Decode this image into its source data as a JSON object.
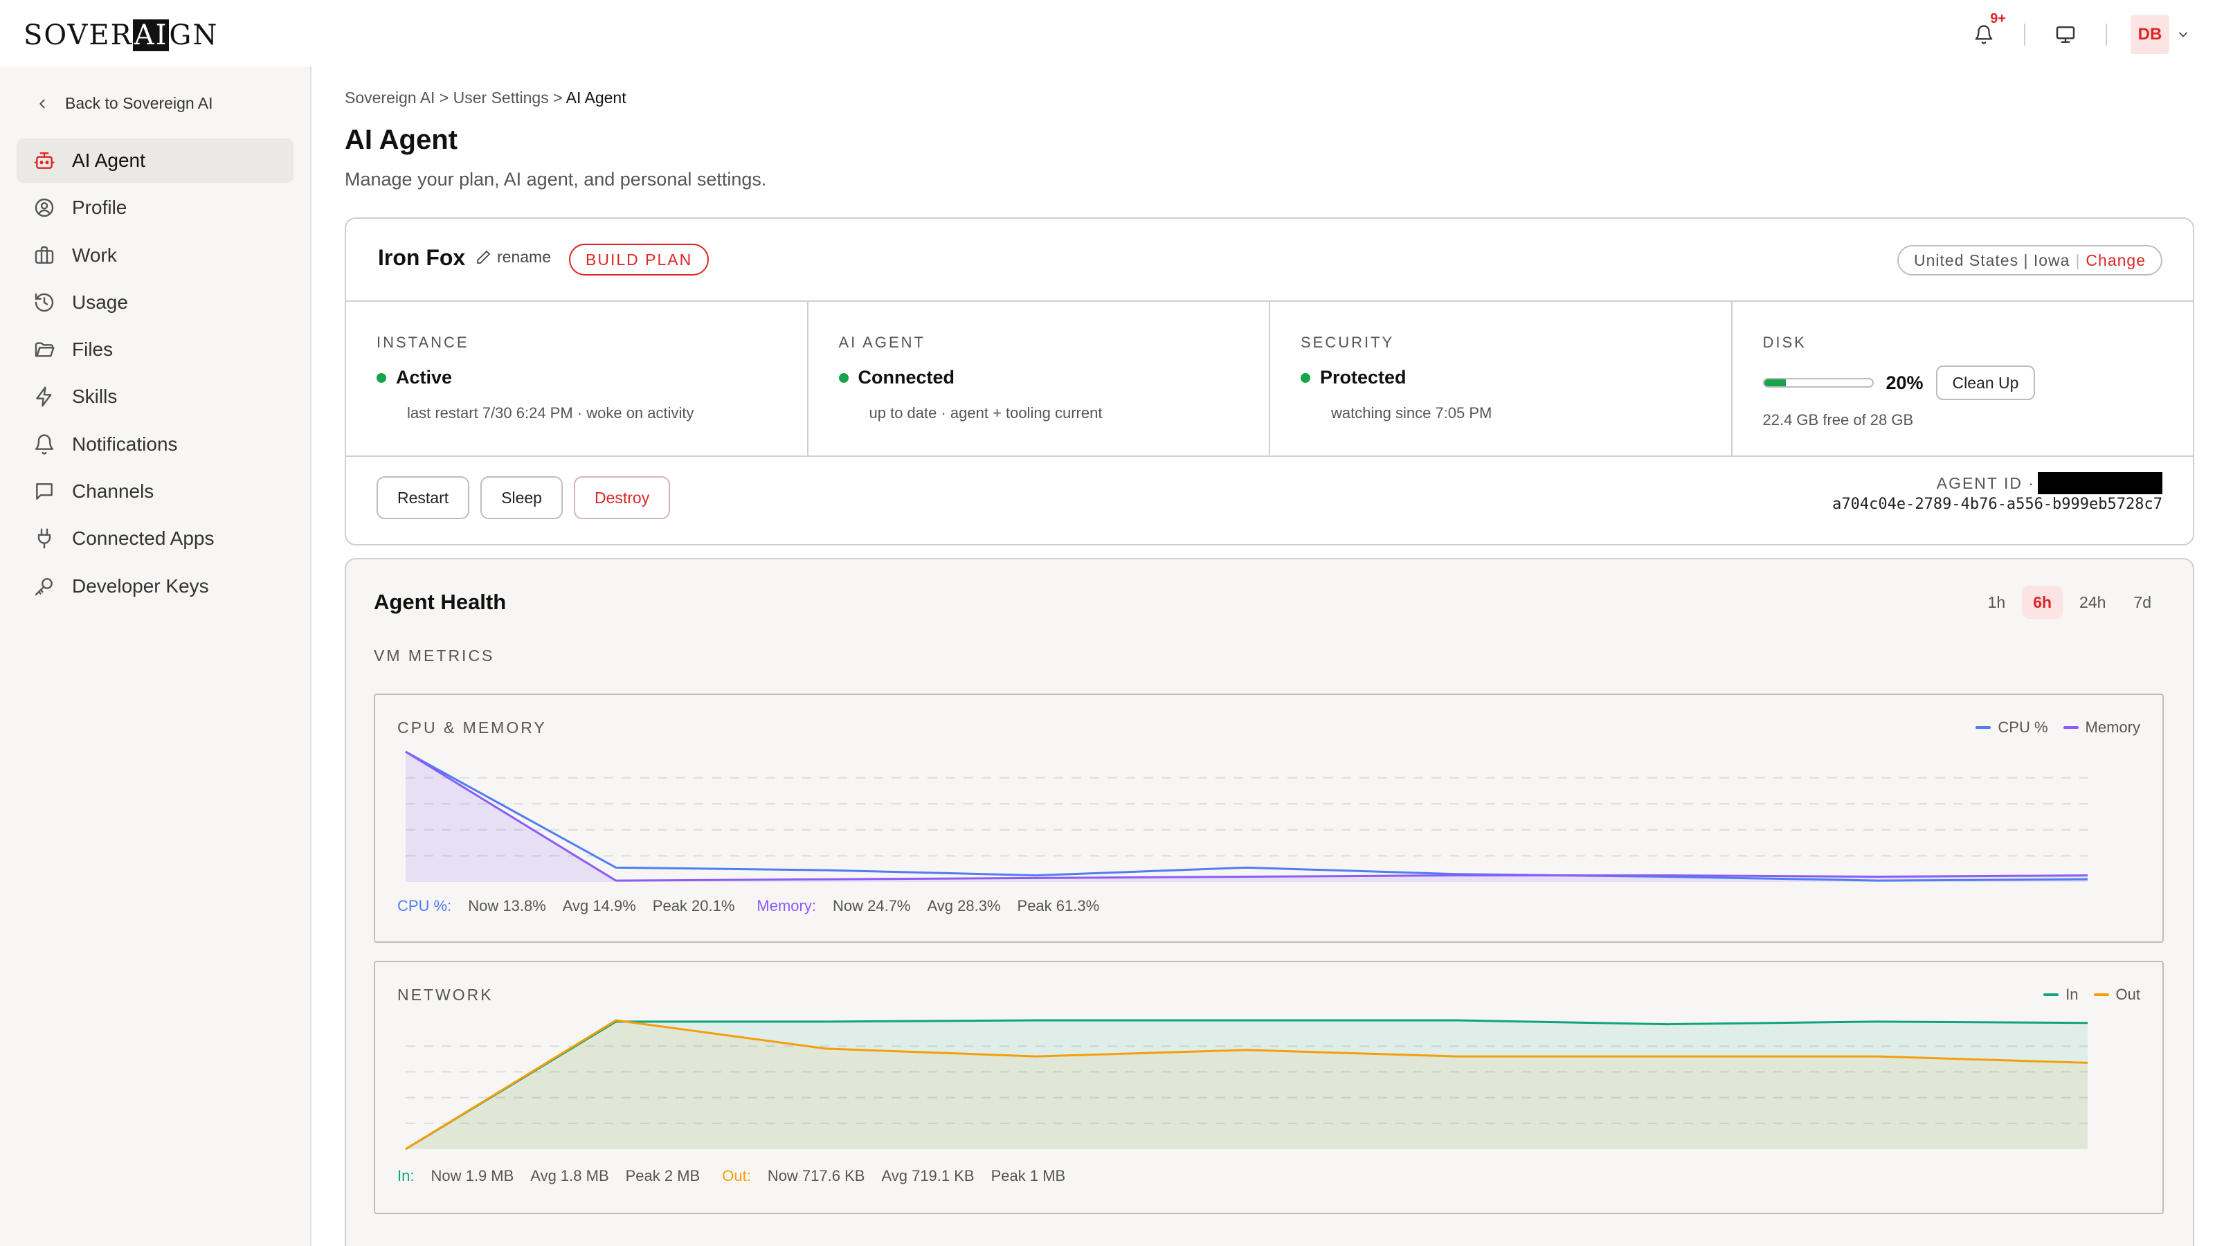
{
  "app": {
    "logo_pre": "SOVER",
    "logo_hl": "AI",
    "logo_post": "GN",
    "notif_badge": "9+",
    "avatar_initials": "DB"
  },
  "sidebar": {
    "back_label": "Back to Sovereign AI",
    "items": [
      {
        "label": "AI Agent",
        "icon": "robot-icon"
      },
      {
        "label": "Profile",
        "icon": "user-circle-icon"
      },
      {
        "label": "Work",
        "icon": "briefcase-icon"
      },
      {
        "label": "Usage",
        "icon": "history-icon"
      },
      {
        "label": "Files",
        "icon": "folder-icon"
      },
      {
        "label": "Skills",
        "icon": "lightning-icon"
      },
      {
        "label": "Notifications",
        "icon": "bell-icon"
      },
      {
        "label": "Channels",
        "icon": "chat-icon"
      },
      {
        "label": "Connected Apps",
        "icon": "plug-icon"
      },
      {
        "label": "Developer Keys",
        "icon": "key-icon"
      }
    ]
  },
  "breadcrumb": {
    "root": "Sovereign AI",
    "sep": ">",
    "mid": "User Settings",
    "current": "AI Agent"
  },
  "page": {
    "title": "AI Agent",
    "subtitle": "Manage your plan, AI agent, and personal settings."
  },
  "agent_card": {
    "name": "Iron Fox",
    "rename_label": "rename",
    "plan_label": "BUILD PLAN",
    "region": "United States | Iowa",
    "region_change": "Change",
    "stats": {
      "instance": {
        "label": "INSTANCE",
        "value": "Active",
        "note": "last restart 7/30 6:24 PM · woke on activity"
      },
      "ai_agent": {
        "label": "AI AGENT",
        "value": "Connected",
        "note": "up to date · agent + tooling current"
      },
      "security": {
        "label": "SECURITY",
        "value": "Protected",
        "note": "watching since 7:05 PM"
      },
      "disk": {
        "label": "DISK",
        "percent_text": "20%",
        "percent": 0.2,
        "cleanup_label": "Clean Up",
        "note": "22.4 GB free of 28 GB"
      }
    },
    "actions": {
      "restart": "Restart",
      "sleep": "Sleep",
      "destroy": "Destroy"
    },
    "agent_id_label": "AGENT ID ·",
    "agent_id": "a704c04e-2789-4b76-a556-b999eb5728c7"
  },
  "health": {
    "title": "Agent Health",
    "ranges": [
      "1h",
      "6h",
      "24h",
      "7d"
    ],
    "active_range": "6h",
    "section_label": "VM METRICS",
    "colors": {
      "cpu": "#4f7df3",
      "memory": "#8b5cf6",
      "in": "#10a37f",
      "out": "#f59e0b"
    },
    "cpu_memory": {
      "title": "CPU & MEMORY",
      "legend_cpu": "CPU %",
      "legend_memory": "Memory",
      "foot": {
        "cpu_label": "CPU %:",
        "cpu_now": "Now 13.8%",
        "cpu_avg": "Avg 14.9%",
        "cpu_peak": "Peak 20.1%",
        "mem_label": "Memory:",
        "mem_now": "Now 24.7%",
        "mem_avg": "Avg 28.3%",
        "mem_peak": "Peak 61.3%"
      }
    },
    "network": {
      "title": "NETWORK",
      "legend_in": "In",
      "legend_out": "Out",
      "foot": {
        "in_label": "In:",
        "in_now": "Now 1.9 MB",
        "in_avg": "Avg 1.8 MB",
        "in_peak": "Peak 2 MB",
        "out_label": "Out:",
        "out_now": "Now 717.6 KB",
        "out_avg": "Avg 719.1 KB",
        "out_peak": "Peak 1 MB"
      }
    }
  },
  "chart_data": [
    {
      "type": "area",
      "title": "CPU & MEMORY",
      "xlabel": "",
      "ylabel": "",
      "ylim": [
        0,
        100
      ],
      "x": [
        0,
        1,
        2,
        3,
        4,
        5,
        6,
        7,
        8
      ],
      "series": [
        {
          "name": "CPU %",
          "values": [
            100,
            11,
            9,
            5,
            11,
            6,
            4,
            1,
            2
          ]
        },
        {
          "name": "Memory",
          "values": [
            100,
            1,
            2,
            3,
            4,
            5,
            5,
            4,
            5
          ]
        }
      ],
      "grid": true,
      "legend": "top-right"
    },
    {
      "type": "area",
      "title": "NETWORK",
      "xlabel": "",
      "ylabel": "",
      "ylim": [
        0,
        100
      ],
      "x": [
        0,
        1,
        2,
        3,
        4,
        5,
        6,
        7,
        8
      ],
      "series": [
        {
          "name": "In",
          "values": [
            0,
            99,
            99,
            100,
            100,
            100,
            97,
            99,
            98
          ]
        },
        {
          "name": "Out",
          "values": [
            0,
            100,
            78,
            72,
            77,
            72,
            72,
            72,
            67
          ]
        }
      ],
      "grid": true,
      "legend": "top-right"
    }
  ]
}
